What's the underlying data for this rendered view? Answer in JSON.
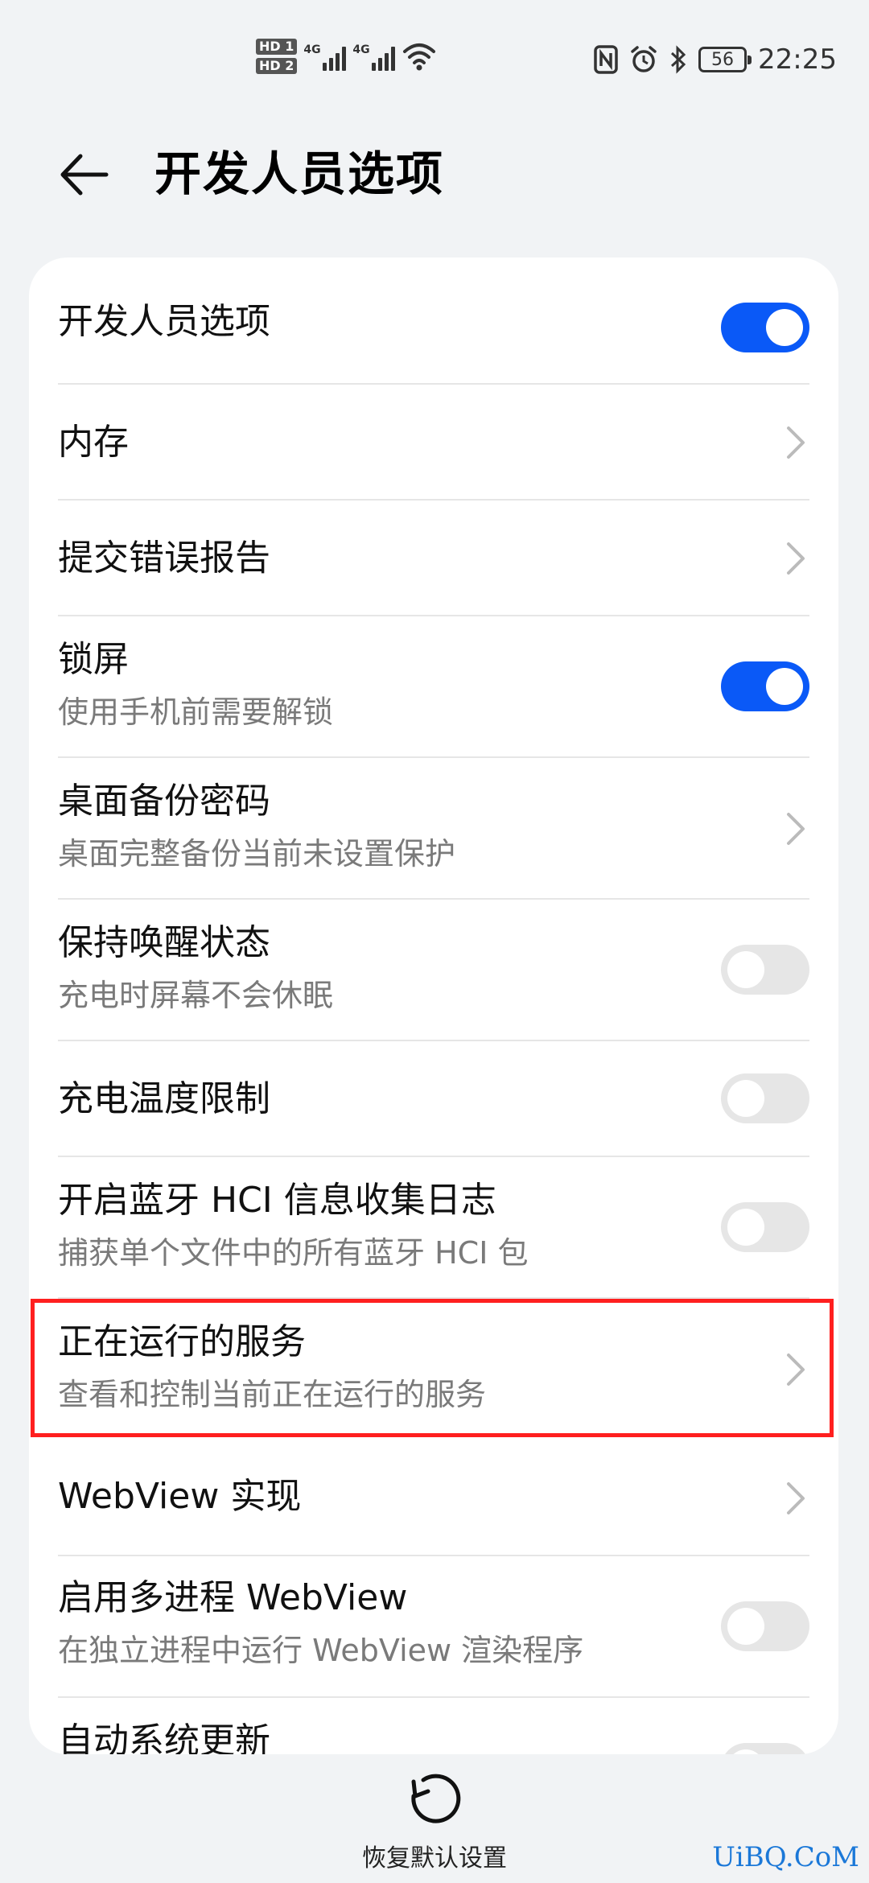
{
  "status_bar": {
    "hd1": "HD 1",
    "hd2": "HD 2",
    "net1": "4G",
    "net2": "4G",
    "battery": "56",
    "time": "22:25"
  },
  "header": {
    "title": "开发人员选项"
  },
  "settings": {
    "items": [
      {
        "title": "开发人员选项",
        "control": "toggle",
        "state": "on"
      },
      {
        "title": "内存",
        "control": "chevron"
      },
      {
        "title": "提交错误报告",
        "control": "chevron"
      },
      {
        "title": "锁屏",
        "subtitle": "使用手机前需要解锁",
        "control": "toggle",
        "state": "on"
      },
      {
        "title": "桌面备份密码",
        "subtitle": "桌面完整备份当前未设置保护",
        "control": "chevron"
      },
      {
        "title": "保持唤醒状态",
        "subtitle": "充电时屏幕不会休眠",
        "control": "toggle",
        "state": "off"
      },
      {
        "title": "充电温度限制",
        "control": "toggle",
        "state": "off"
      },
      {
        "title": "开启蓝牙 HCI 信息收集日志",
        "subtitle": "捕获单个文件中的所有蓝牙 HCI 包",
        "control": "toggle",
        "state": "off"
      },
      {
        "title": "正在运行的服务",
        "subtitle": "查看和控制当前正在运行的服务",
        "control": "chevron",
        "highlighted": true
      },
      {
        "title": "WebView 实现",
        "control": "chevron"
      },
      {
        "title": "启用多进程 WebView",
        "subtitle": "在独立进程中运行 WebView 渲染程序",
        "control": "toggle",
        "state": "off"
      },
      {
        "title": "自动系统更新",
        "control": "toggle",
        "state": "off"
      }
    ]
  },
  "footer": {
    "reset_label": "恢复默认设置"
  },
  "watermark": "UiBQ.CoM",
  "colors": {
    "accent": "#0a59f7",
    "highlight_border": "#ff1f1f",
    "background": "#f1f3f5"
  }
}
